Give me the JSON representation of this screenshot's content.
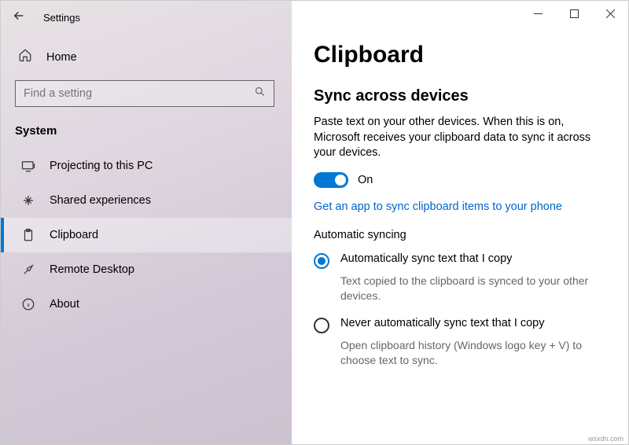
{
  "titlebar": {
    "title": "Settings"
  },
  "home": {
    "label": "Home"
  },
  "search": {
    "placeholder": "Find a setting"
  },
  "category": "System",
  "nav": {
    "items": [
      {
        "label": "Projecting to this PC"
      },
      {
        "label": "Shared experiences"
      },
      {
        "label": "Clipboard"
      },
      {
        "label": "Remote Desktop"
      },
      {
        "label": "About"
      }
    ]
  },
  "page": {
    "title": "Clipboard",
    "section_title": "Sync across devices",
    "description": "Paste text on your other devices. When this is on, Microsoft receives your clipboard data to sync it across your devices.",
    "toggle_state": "On",
    "link": "Get an app to sync clipboard items to your phone",
    "auto_sync_heading": "Automatic syncing",
    "radio1": {
      "label": "Automatically sync text that I copy",
      "sub": "Text copied to the clipboard is synced to your other devices."
    },
    "radio2": {
      "label": "Never automatically sync text that I copy",
      "sub": "Open clipboard history (Windows logo key + V) to choose text to sync."
    }
  },
  "watermark": "wsxdn.com"
}
